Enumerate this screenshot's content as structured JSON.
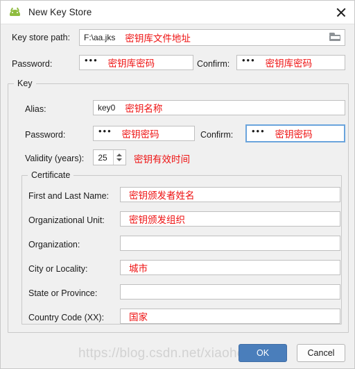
{
  "window": {
    "title": "New Key Store",
    "icon": "android-robot-icon",
    "close_label": "×",
    "accent_color": "#4a7ebb",
    "annotation_color": "#ee1111",
    "android_green": "#8fbc3f",
    "focus_border_color": "#6aa4dc"
  },
  "keystore": {
    "path_label": "Key store path:",
    "path_value": "F:\\aa.jks",
    "path_annotation": "密钥库文件地址",
    "browse_icon": "folder-icon",
    "password_label": "Password:",
    "password_value": "•••",
    "password_annotation": "密钥库密码",
    "confirm_label": "Confirm:",
    "confirm_value": "•••",
    "confirm_annotation": "密钥库密码"
  },
  "key_group": {
    "legend": "Key",
    "alias_label": "Alias:",
    "alias_value": "key0",
    "alias_annotation": "密钥名称",
    "password_label": "Password:",
    "password_value": "•••",
    "password_annotation": "密钥密码",
    "confirm_label": "Confirm:",
    "confirm_value": "•••",
    "confirm_annotation": "密钥密码",
    "validity_label": "Validity (years):",
    "validity_value": "25",
    "validity_annotation": "密钥有效时间"
  },
  "certificate": {
    "legend": "Certificate",
    "fields": [
      {
        "label": "First and Last Name:",
        "value": "",
        "annotation": "密钥颁发者姓名"
      },
      {
        "label": "Organizational Unit:",
        "value": "",
        "annotation": "密钥颁发组织"
      },
      {
        "label": "Organization:",
        "value": "",
        "annotation": ""
      },
      {
        "label": "City or Locality:",
        "value": "",
        "annotation": "城市"
      },
      {
        "label": "State or Province:",
        "value": "",
        "annotation": ""
      },
      {
        "label": "Country Code (XX):",
        "value": "",
        "annotation": "国家"
      }
    ]
  },
  "footer": {
    "ok_label": "OK",
    "cancel_label": "Cancel",
    "watermark": "https://blog.csdn.net/xiaohelan"
  }
}
